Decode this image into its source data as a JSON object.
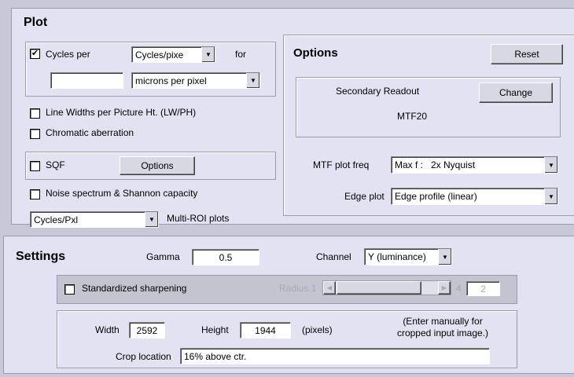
{
  "plot": {
    "title": "Plot",
    "cycles_per_checked": "✔",
    "cycles_per_label": "Cycles per",
    "cycles_unit_value": "Cycles/pixe",
    "for_label": "for",
    "microns_input_value": "",
    "microns_value": "microns per pixel",
    "lwph_label": "Line Widths per Picture Ht. (LW/PH)",
    "chromatic_label": "Chromatic aberration",
    "sqf_label": "SQF",
    "sqf_options_label": "Options",
    "noise_label": "Noise spectrum & Shannon capacity",
    "multiroi_select_value": "Cycles/Pxl",
    "multiroi_label": "Multi-ROI plots"
  },
  "options": {
    "title": "Options",
    "reset_label": "Reset",
    "secondary_readout_label": "Secondary Readout",
    "change_label": "Change",
    "readout_value": "MTF20",
    "mtf_freq_label": "MTF plot freq",
    "mtf_freq_value": "Max f :   2x Nyquist",
    "edge_plot_label": "Edge plot",
    "edge_plot_value": "Edge profile (linear)"
  },
  "settings": {
    "title": "Settings",
    "gamma_label": "Gamma",
    "gamma_value": "0.5",
    "channel_label": "Channel",
    "channel_value": "Y (luminance)",
    "std_sharpening_label": "Standardized sharpening",
    "radius_label": "Radius",
    "radius_min": "1",
    "radius_max": "4",
    "radius_value": "2",
    "width_label": "Width",
    "width_value": "2592",
    "height_label": "Height",
    "height_value": "1944",
    "pixels_label": "(pixels)",
    "note_line1": "(Enter manually for",
    "note_line2": "cropped input image.)",
    "crop_label": "Crop location",
    "crop_value": "16% above ctr."
  },
  "colors": {
    "panel": "#e2e2f2",
    "background": "#c8c8d8",
    "groupbox_border": "#9a9ab0"
  },
  "icons": {
    "check": "check-mark-icon",
    "dropdown": "dropdown-arrow-icon",
    "scroll_left": "scroll-left-icon",
    "scroll_right": "scroll-right-icon"
  }
}
